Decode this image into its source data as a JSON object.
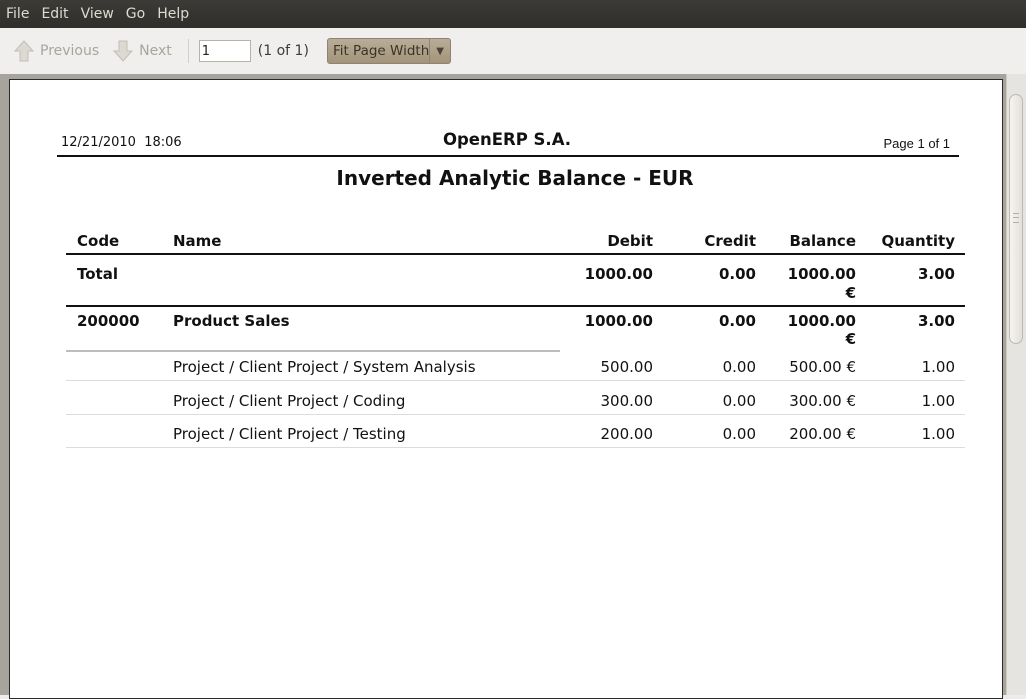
{
  "menubar": {
    "items": [
      "File",
      "Edit",
      "View",
      "Go",
      "Help"
    ]
  },
  "toolbar": {
    "previous_label": "Previous",
    "next_label": "Next",
    "page_value": "1",
    "page_count": "(1 of 1)",
    "zoom_value": "Fit Page Width",
    "previous_icon": "arrow-up-icon",
    "next_icon": "arrow-down-icon",
    "dropdown_icon": "chevron-down-icon"
  },
  "report": {
    "date": "12/21/2010  18:06",
    "company": "OpenERP S.A.",
    "page_number": "Page 1 of 1",
    "title": "Inverted Analytic Balance - EUR",
    "columns": {
      "code": "Code",
      "name": "Name",
      "debit": "Debit",
      "credit": "Credit",
      "balance": "Balance",
      "quantity": "Quantity"
    },
    "total": {
      "label": "Total",
      "debit": "1000.00",
      "credit": "0.00",
      "balance_amount": "1000.00",
      "balance_currency": "€",
      "quantity": "3.00"
    },
    "account": {
      "code": "200000",
      "name": "Product Sales",
      "debit": "1000.00",
      "credit": "0.00",
      "balance_amount": "1000.00",
      "balance_currency": "€",
      "quantity": "3.00"
    },
    "lines": [
      {
        "name": "Project / Client Project / System Analysis",
        "debit": "500.00",
        "credit": "0.00",
        "balance": "500.00 €",
        "quantity": "1.00"
      },
      {
        "name": "Project / Client Project / Coding",
        "debit": "300.00",
        "credit": "0.00",
        "balance": "300.00 €",
        "quantity": "1.00"
      },
      {
        "name": "Project / Client Project / Testing",
        "debit": "200.00",
        "credit": "0.00",
        "balance": "200.00 €",
        "quantity": "1.00"
      }
    ]
  }
}
